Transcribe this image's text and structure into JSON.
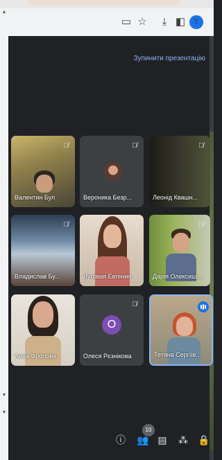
{
  "browser": {
    "icons": [
      "video-icon",
      "star-icon",
      "download-icon",
      "sidebar-icon",
      "profile-avatar"
    ],
    "avatar_letter": "T"
  },
  "meet": {
    "present_stop": "Зупинити презентацію",
    "participants": [
      {
        "name": "Валентин Бул",
        "muted": true
      },
      {
        "name": "Вероника Безр...",
        "muted": true
      },
      {
        "name": "Леонід Квашн...",
        "muted": true
      },
      {
        "name": "Владислав Бу...",
        "muted": true
      },
      {
        "name": "Луговая Евгения",
        "muted": true
      },
      {
        "name": "Дарія Олексиш...",
        "muted": true
      },
      {
        "name": "Анна Фролова",
        "muted": true
      },
      {
        "name": "Олеся Рєзнікова",
        "muted": true,
        "initial": "О"
      },
      {
        "name": "Тетяна Сергіїв...",
        "muted": false,
        "speaking": true
      }
    ],
    "participant_count": "10"
  },
  "colors": {
    "accent": "#8ab4f8",
    "meet_bg": "#202124",
    "tile_bg": "#3c4043",
    "avatar_purple": "#7b4fb3"
  }
}
